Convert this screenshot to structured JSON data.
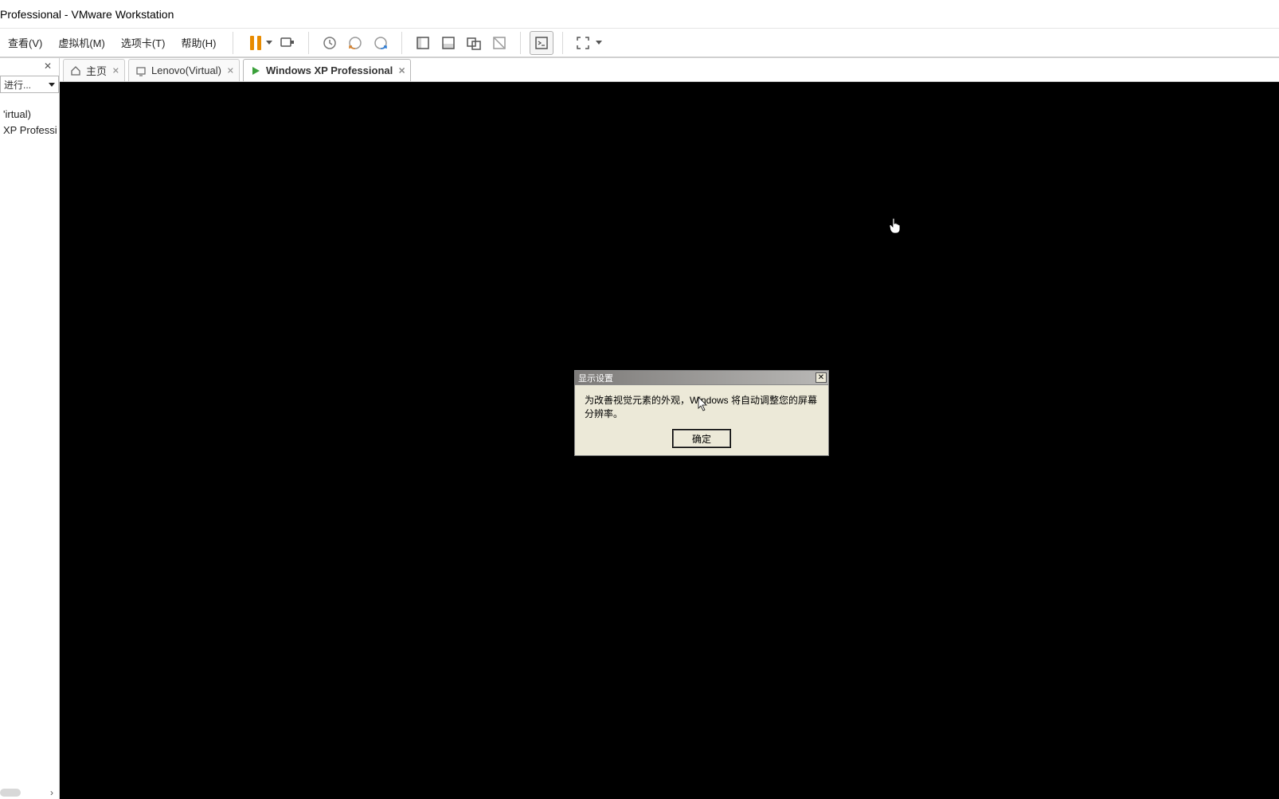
{
  "window": {
    "title": "Professional - VMware Workstation"
  },
  "menu": {
    "items": [
      {
        "label": "查看(V)"
      },
      {
        "label": "虚拟机(M)"
      },
      {
        "label": "选项卡(T)"
      },
      {
        "label": "帮助(H)"
      }
    ]
  },
  "toolbar": {
    "pause_icon": "pause-icon",
    "usb_icon": "usb-icon",
    "snapshot_back_icon": "snapshot-back-icon",
    "snapshot_forward_icon": "snapshot-forward-icon",
    "snapshot_manage_icon": "snapshot-manage-icon",
    "view_single_icon": "view-single-icon",
    "view_split_icon": "view-split-icon",
    "view_unity_icon": "view-unity-icon",
    "view_fullpin_icon": "view-fullpin-icon",
    "console_icon": "console-icon",
    "fullscreen_icon": "fullscreen-icon"
  },
  "sidebar": {
    "search_placeholder": "进行...",
    "items": [
      {
        "label": "'irtual)"
      },
      {
        "label": "XP Professi"
      }
    ]
  },
  "tabs": [
    {
      "label": "主页",
      "icon": "home-icon",
      "active": false,
      "closable": true
    },
    {
      "label": "Lenovo(Virtual)",
      "icon": "vm-icon",
      "active": false,
      "closable": true
    },
    {
      "label": "Windows XP Professional",
      "icon": "play-icon",
      "active": true,
      "closable": true
    }
  ],
  "dialog": {
    "title": "显示设置",
    "message": "为改善视觉元素的外观，Windows 将自动调整您的屏幕分辨率。",
    "ok_label": "确定"
  }
}
